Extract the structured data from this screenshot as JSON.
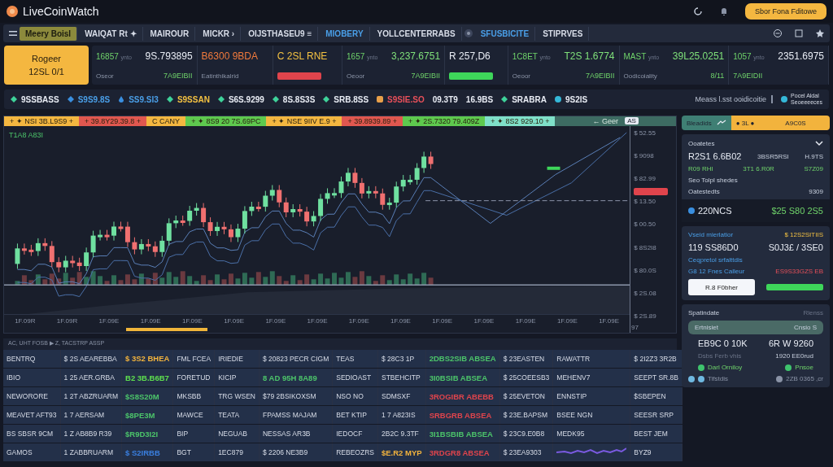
{
  "header": {
    "brand": "LiveCoinWatch",
    "button": "Sbor Fona Fditowe"
  },
  "nav": [
    {
      "kind": "tab",
      "text": "Meery Boisl",
      "selected": true
    },
    {
      "kind": "tab",
      "text": "WAIQAT Rt ✦",
      "selected": false,
      "color": "#d8dde8"
    },
    {
      "kind": "tab",
      "text": "MAIROUR",
      "selected": false,
      "color": "#d8dde8"
    },
    {
      "kind": "tab",
      "text": "MICKR ›",
      "selected": false,
      "color": "#d8dde8"
    },
    {
      "kind": "tab",
      "text": "OIJSTHASEU9 ≡",
      "selected": false,
      "color": "#d8dde8"
    },
    {
      "kind": "tab",
      "text": "MIOBERY",
      "selected": false,
      "color": "#4a9fe8"
    },
    {
      "kind": "tab",
      "text": "YOLLCENTERRABS",
      "selected": false,
      "color": "#d8dde8"
    },
    {
      "kind": "icon"
    },
    {
      "kind": "tab",
      "text": "SFUSBICITE",
      "selected": false,
      "color": "#4a9fe8"
    },
    {
      "kind": "tab",
      "text": "STIPRVES",
      "selected": false,
      "color": "#d8dde8"
    }
  ],
  "feature": {
    "label": "Rogeer",
    "value": "12SL 0/1"
  },
  "tickers": [
    {
      "symbol": "16857",
      "unit": "ynto",
      "price": "9S.793895",
      "color": "#e8ecf4",
      "label": "Oseor",
      "value": "7A9EIBII"
    },
    {
      "price": "B6300 9BDA",
      "color": "#f07a3c",
      "label": "Eatinthikalrid"
    },
    {
      "price": "C 2SL RNE",
      "color": "#f4c242",
      "pill": {
        "color": "#e0444c"
      }
    },
    {
      "symbol": "1657",
      "unit": "ynto",
      "price": "3,237.6751",
      "color": "#7fe07a",
      "label": "Oeoor",
      "value": "7A9EIBII"
    },
    {
      "price": "R 257,D6",
      "color": "#e8ecf4",
      "pill": {
        "color": "#3ed65a"
      }
    },
    {
      "symbol": "1C8ET",
      "unit": "ynto",
      "price": "T2S 1.6774",
      "color": "#7fe07a",
      "label": "Oeoor",
      "value": "7A9EIBII"
    },
    {
      "symbol": "MAST",
      "unit": "ynto",
      "price": "39L25.0251",
      "color": "#7fe07a",
      "label": "Oodicoiality",
      "value": "8/11"
    },
    {
      "symbol": "1057",
      "unit": "ynto",
      "price": "2351.6975",
      "color": "#e8ecf4",
      "value": "7A9EIDII"
    }
  ],
  "coins": [
    {
      "text": "9SSBASS",
      "color": "#e8ecf4",
      "kind": "diamond"
    },
    {
      "text": "S9S9.8S",
      "color": "#4a9fe8",
      "kind": "gem"
    },
    {
      "text": "SS9.SI3",
      "color": "#4a9fe8",
      "kind": "drop"
    },
    {
      "text": "S9SSAN",
      "color": "#f4c242",
      "kind": "diamond"
    },
    {
      "text": "S6S.9299",
      "color": "#e8ecf4",
      "kind": "diamond"
    },
    {
      "text": "8S.8S3S",
      "color": "#e8ecf4",
      "kind": "diamond"
    },
    {
      "text": "SRB.8SS",
      "color": "#e8ecf4",
      "kind": "diamond"
    },
    {
      "text": "S9SIE.SO",
      "color": "#e8505a",
      "kind": "square"
    },
    {
      "text": "09.3T9",
      "color": "#e8ecf4",
      "kind": "plain"
    },
    {
      "text": "16.9BS",
      "color": "#e8ecf4",
      "kind": "plain"
    },
    {
      "text": "SRABRA",
      "color": "#e8ecf4",
      "kind": "diamond"
    },
    {
      "text": "9S2IS",
      "color": "#e8ecf4",
      "kind": "circle"
    }
  ],
  "coin_note": "Meass l.sst ooidicoitie",
  "coin_badge": {
    "title": "Pocel Aldal",
    "subtitle": "Seoeeeeces"
  },
  "chart": {
    "tabs": [
      {
        "text": "+ ✦ NSI 3B.L9S9 +",
        "color": "#f4b740"
      },
      {
        "text": "+ 39.8Y29.39.8 +",
        "color": "#e0574f"
      },
      {
        "text": "C CANY",
        "color": "#f4b740"
      },
      {
        "text": "+ ✦ 8S9 20 7S.69PC",
        "color": "#5ec94e"
      },
      {
        "text": "+ ✦ NSE 9IIV E.9 +",
        "color": "#f4b740"
      },
      {
        "text": "+ 39.8939.89 +",
        "color": "#e0574f"
      },
      {
        "text": "+ ✦ 2S.7320 79.409Z",
        "color": "#5ec94e"
      },
      {
        "text": "+ ✦ 8S2 929.10 +",
        "color": "#7fe0c8"
      }
    ],
    "range": {
      "text": "← Geer",
      "badge": "AS"
    },
    "label": "T1A8 A83I",
    "yaxis": [
      "$ 52.55",
      "$ 9098",
      "$ 82.99",
      "$ 13.50",
      "$ 00.50",
      "$ 8S2I8",
      "$ 80.0S",
      "$ 2S.08",
      "$ 2S.89"
    ],
    "xaxis": [
      "1F.09R",
      "1F.09R",
      "1F.09E",
      "1F.09E",
      "1F.09E",
      "1F.09E",
      "1F.09E",
      "1F.09E",
      "1F.09E",
      "1F.09E",
      "1F.09E",
      "1F.09E",
      "1F.09E",
      "1F.09E",
      "1F.09E"
    ],
    "corner": "97"
  },
  "side_tabs": [
    {
      "text": "Bleadids",
      "selected": true
    },
    {
      "text": "● 3L ●",
      "selected": false
    },
    {
      "text": "A9C0S",
      "selected": false
    }
  ],
  "stats": {
    "title": "Ooatetes",
    "expanded": true,
    "rows": [
      [
        "R2S1 6.6B02",
        "3BSR5RSI",
        "H.9TS"
      ],
      [
        "R09 RHI",
        "3T1 6.R0R",
        "S7Z09"
      ]
    ],
    "subtitle": "Seo Tolpl shedes",
    "line": {
      "label": "Oatestedts",
      "value": "9309"
    },
    "coin": {
      "name": "220NCS",
      "value": "$25 S80 2S5"
    }
  },
  "volume": {
    "title": "Vseid mierlatior",
    "amount": "$ 12S2SITIIS",
    "left": "119 SS86D0",
    "right": "S0J3£ / 3SE0",
    "link": "Ceqpretol srfalttdis",
    "note": "G8 12 Fnes Calleur",
    "note_value": "ES9S33GZS EB",
    "button": "R.8 F0bher",
    "level": 1
  },
  "summary": {
    "title": "Spatindate",
    "action": "Rlenss",
    "bar": {
      "left": "Ertnisiet",
      "right": "Cnsio S"
    },
    "big": [
      "EB9C 0 10K",
      "6R W 9260"
    ],
    "small": {
      "label": "Dsbs Ferb vhis",
      "value": "1920 EE0rud"
    },
    "statuses": [
      {
        "text": "Darl Orniloy",
        "color": "#3ec46d"
      },
      {
        "text": "Pnsoe",
        "color": "#3ec46d"
      }
    ],
    "footer": {
      "label": "Tifstdis",
      "value": "2ZB 0365 ,cr"
    }
  },
  "table": {
    "caption": "AC, UHT FOSB ▶ Z, TACSTRP ASSP",
    "rows": [
      {
        "cells": [
          "BENTRQ",
          "$ 2S AEAREBBA",
          {
            "text": "$ 3S2 BHEA",
            "color": "#f2b33d"
          },
          "FML FCEA",
          "IRIEDIE",
          "$ 20823 PECR CIGM",
          "TEAS",
          "$ 28C3 1P",
          {
            "text": "2DBS2SIB ABSEA",
            "color": "#4cc46a"
          },
          "$ 23EASTEN",
          "RAWATTR",
          "$ 2I2Z3 3R2B"
        ]
      },
      {
        "cells": [
          "IBIO",
          "1 25 AER.GRBA",
          {
            "text": "B2 3B.B6B7",
            "color": "#5ee04e"
          },
          "FORETUD",
          "KICIP",
          {
            "text": "8 AD 95H 8A89",
            "color": "#4cc46a"
          },
          "SEDIOAST",
          "STBEHCITP",
          {
            "text": "3I0BSIB ABSEA",
            "color": "#4cc46a"
          },
          "$ 25COEESB3",
          "MEHENV7",
          "SEEPT SR.8B"
        ]
      },
      {
        "cells": [
          "NEWORORE",
          "1 2T ABZRUARM",
          {
            "text": "$S8S20M",
            "color": "#4cc46a"
          },
          "MKSBB",
          "TRG WSEN",
          "$79 2BSIKOXSM",
          "NSO NO",
          "SDMSXF",
          {
            "text": "3ROGIBR ABEBB",
            "color": "#e0444c"
          },
          "$ 25EVETON",
          "ENNSTIP",
          "$SBEPEN"
        ]
      },
      {
        "cells": [
          "MEAVET AFT93",
          "1 7 AERSAM",
          {
            "text": "$8PE3M",
            "color": "#4cc46a"
          },
          "MAWCE",
          "TEATA",
          "FPAMSS MAJAM",
          "BET KTIP",
          "1 7 A823IS",
          {
            "text": "SRBGRB ABSEA",
            "color": "#e0444c"
          },
          "$ 23E.BAPSM",
          "BSEE NGN",
          "SEESR SRP"
        ]
      },
      {
        "cells": [
          "BS SBSR 9CM",
          "1 Z AB8B9 R39",
          {
            "text": "$R9D3I2I",
            "color": "#4cc46a"
          },
          "BIP",
          "NEGUAB",
          "NESSAS AR3B",
          "IEDOCF",
          "2B2C 9.3TF",
          {
            "text": "3I1BSBIB ABSEA",
            "color": "#4cc46a"
          },
          "$ 23C9.E0B8",
          "MEDK95",
          "BEST JEM"
        ]
      },
      {
        "cells": [
          "GAMOS",
          "1 ZABBRUARM",
          {
            "text": "$ S2IRBB",
            "color": "#3a7fe0"
          },
          "BGT",
          "1EC879",
          "$ 2206 NE3B9",
          "REBEOZRS",
          {
            "text": "$E.R2 MYP",
            "color": "#f2b33d"
          },
          {
            "text": "3RDGR8 ABSEA",
            "color": "#e0444c"
          },
          "$ 23EA9303",
          {
            "kind": "sparkline"
          },
          "BYZ9"
        ]
      }
    ]
  }
}
